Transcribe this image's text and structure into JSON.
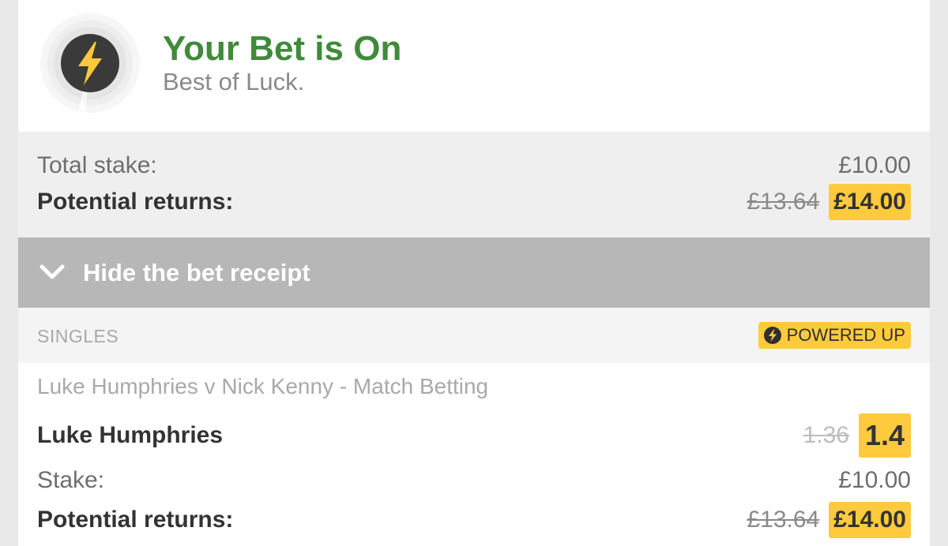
{
  "header": {
    "title": "Your Bet is On",
    "subtitle": "Best of Luck."
  },
  "totals": {
    "stake_label": "Total stake:",
    "stake_value": "£10.00",
    "returns_label": "Potential returns:",
    "returns_old": "£13.64",
    "returns_new": "£14.00"
  },
  "receipt_toggle": {
    "label": "Hide the bet receipt"
  },
  "singles": {
    "label": "SINGLES",
    "badge": "POWERED UP"
  },
  "bet": {
    "market": "Luke Humphries v Nick Kenny - Match Betting",
    "selection": "Luke Humphries",
    "odds_old": "1.36",
    "odds_new": "1.4",
    "stake_label": "Stake:",
    "stake_value": "£10.00",
    "returns_label": "Potential returns:",
    "returns_old": "£13.64",
    "returns_new": "£14.00"
  },
  "colors": {
    "title_green": "#3f8b3a",
    "highlight_yellow": "#ffcb3d",
    "toggle_grey": "#b7b7b7"
  },
  "icons": [
    "lightning-bolt-icon",
    "chevron-down-icon",
    "powered-up-icon"
  ]
}
